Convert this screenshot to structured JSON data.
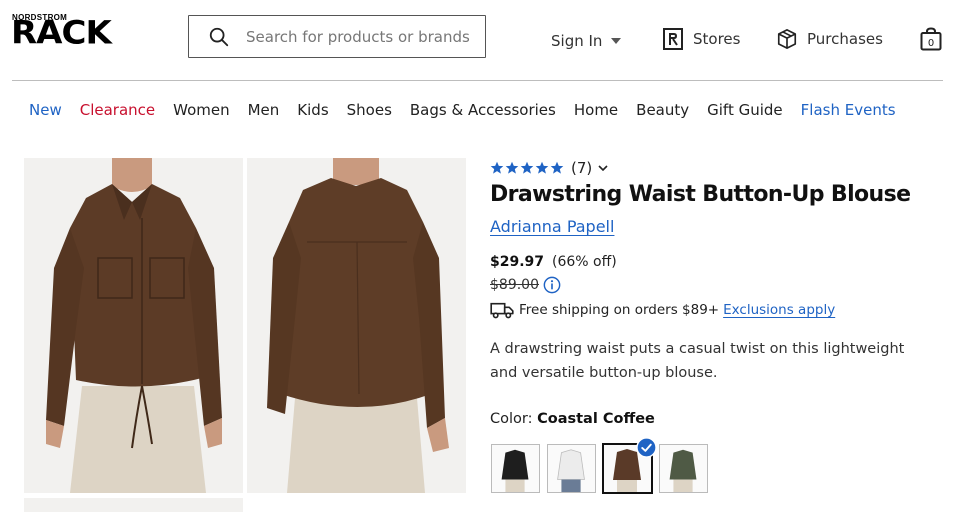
{
  "brand": {
    "top": "NORDSTROM",
    "main": "RACK"
  },
  "search": {
    "placeholder": "Search for products or brands"
  },
  "header": {
    "sign_in": "Sign In",
    "stores": "Stores",
    "purchases": "Purchases"
  },
  "nav": [
    {
      "label": "New",
      "color": "#1f63c4"
    },
    {
      "label": "Clearance",
      "color": "#c8102e"
    },
    {
      "label": "Women"
    },
    {
      "label": "Men"
    },
    {
      "label": "Kids"
    },
    {
      "label": "Shoes"
    },
    {
      "label": "Bags & Accessories"
    },
    {
      "label": "Home"
    },
    {
      "label": "Beauty"
    },
    {
      "label": "Gift Guide"
    },
    {
      "label": "Flash Events",
      "color": "#1f63c4"
    }
  ],
  "product": {
    "rating_stars": 5,
    "rating_count": "(7)",
    "title": "Drawstring Waist Button-Up Blouse",
    "brand": "Adrianna Papell",
    "price": "$29.97",
    "discount": "(66% off)",
    "original_price": "$89.00",
    "shipping_text": "Free shipping on orders $89+",
    "shipping_link": "Exclusions apply",
    "description": "A drawstring waist puts a casual twist on this lightweight and versatile button-up blouse.",
    "color_label": "Color:",
    "color_value": "Coastal Coffee",
    "swatches": [
      {
        "name": "black",
        "color": "#1e1e1e"
      },
      {
        "name": "white",
        "color": "#ececec"
      },
      {
        "name": "coastal-coffee",
        "color": "#5a3a28",
        "selected": true
      },
      {
        "name": "olive",
        "color": "#4f5a45"
      }
    ]
  },
  "colors": {
    "accent_blue": "#1f63c4",
    "sale_red": "#c8102e",
    "blouse_brown": "#5c3b26"
  }
}
